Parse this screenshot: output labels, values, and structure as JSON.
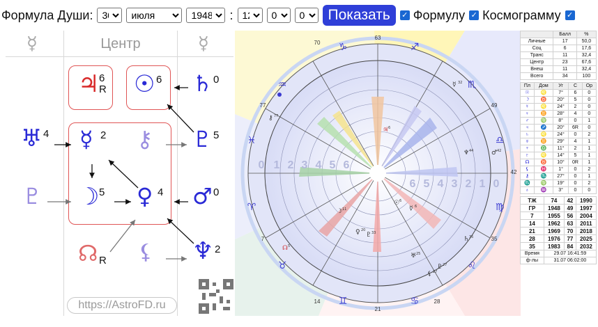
{
  "toolbar": {
    "formula_label": "Формула Души:",
    "day": "30",
    "month": "июля",
    "year": "1948",
    "colon": ":",
    "hour": "12",
    "minute": "00",
    "second": "00",
    "show_button": "Показать",
    "formula_checkbox": "Формулу",
    "cosmogram_checkbox": "Космограмму"
  },
  "formula": {
    "left_top_glyph": "☿",
    "center_title": "Центр",
    "right_top_glyph": "☿",
    "jupiter": {
      "glyph": "♃",
      "num": "6",
      "sub": "R"
    },
    "sun": {
      "glyph": "☉",
      "num": "6"
    },
    "saturn": {
      "glyph": "♄",
      "num": "0"
    },
    "uranus": {
      "glyph": "♅",
      "num": "4"
    },
    "mercury": {
      "glyph": "☿",
      "num": "2"
    },
    "chiron": {
      "glyph": "⚷",
      "num": ""
    },
    "pluto_right": {
      "glyph": "♇",
      "num": "5"
    },
    "pluto_left": {
      "glyph": "♇",
      "num": ""
    },
    "moon": {
      "glyph": "☽",
      "num": "5"
    },
    "venus": {
      "glyph": "♀",
      "num": "4"
    },
    "mars": {
      "glyph": "♂",
      "num": "0"
    },
    "node": {
      "glyph": "☊",
      "sub": "R"
    },
    "lilith": {
      "glyph": "⚸",
      "num": ""
    },
    "neptune": {
      "glyph": "♆",
      "num": "2"
    },
    "site": "https://AstroFD.ru"
  },
  "chart": {
    "degree_labels": [
      "63",
      "49",
      "42",
      "35",
      "28",
      "21",
      "14",
      "7",
      "77",
      "70"
    ],
    "ring_numbers_left": [
      "0",
      "1",
      "2",
      "3",
      "4",
      "5",
      "6"
    ],
    "ring_numbers_right": [
      "6",
      "5",
      "4",
      "3",
      "2",
      "1",
      "0"
    ],
    "zodiac": [
      "♈",
      "♉",
      "♊",
      "♋",
      "♌",
      "♍",
      "♎",
      "♏",
      "♐",
      "♑",
      "♒",
      "♓"
    ],
    "planet_marks": [
      {
        "glyph": "♃",
        "label": "6"
      },
      {
        "glyph": "♆",
        "label": "44"
      },
      {
        "glyph": "♂",
        "label": "42"
      },
      {
        "glyph": "☿",
        "label": "32"
      },
      {
        "glyph": "☊",
        "label": "5"
      },
      {
        "glyph": "☽",
        "label": "11"
      },
      {
        "glyph": "☉",
        "label": "6"
      },
      {
        "glyph": "☿",
        "label": "6"
      },
      {
        "glyph": "♀",
        "label": "20"
      },
      {
        "glyph": "♇",
        "label": "33"
      },
      {
        "glyph": "♄",
        "label": "35"
      },
      {
        "glyph": "♅",
        "label": "25"
      },
      {
        "glyph": "⚸",
        "label": "27"
      },
      {
        "glyph": "♇",
        "label": "27"
      },
      {
        "glyph": "⚷",
        "label": "77"
      }
    ]
  },
  "stats": {
    "header": [
      "",
      "Балл",
      "%"
    ],
    "rows": [
      [
        "Личные",
        "17",
        "50,0"
      ],
      [
        "Соц",
        "6",
        "17,6"
      ],
      [
        "Транс",
        "11",
        "32,4"
      ],
      [
        "Центр",
        "23",
        "67,6"
      ],
      [
        "Внеш",
        "11",
        "32,4"
      ],
      [
        "Всего",
        "34",
        "100"
      ]
    ],
    "planet_header": [
      "Пл",
      "Дом",
      "Уг",
      "С",
      "Ор"
    ],
    "planet_rows": [
      [
        "☉",
        "♌",
        "7°",
        "6",
        "0"
      ],
      [
        "☽",
        "♉",
        "20°",
        "5",
        "0"
      ],
      [
        "☿",
        "♌",
        "24°",
        "2",
        "0"
      ],
      [
        "♀",
        "♊",
        "28°",
        "4",
        "0"
      ],
      [
        "♂",
        "♍",
        "8°",
        "0",
        "1"
      ],
      [
        "♃",
        "♐",
        "20°",
        "6R",
        "0"
      ],
      [
        "♄",
        "♌",
        "24°",
        "0",
        "2"
      ],
      [
        "♅",
        "♊",
        "29°",
        "4",
        "1"
      ],
      [
        "♆",
        "♎",
        "11°",
        "2",
        "1"
      ],
      [
        "♇",
        "♌",
        "14°",
        "5",
        "1"
      ],
      [
        "☊",
        "♉",
        "10°",
        "0R",
        "1"
      ],
      [
        "⚸",
        "♓",
        "1°",
        "0",
        "2"
      ],
      [
        "⚷",
        "♏",
        "27°",
        "0",
        "1"
      ],
      [
        "♏",
        "♍",
        "19°",
        "0",
        "2"
      ],
      [
        "♁",
        "♒",
        "3°",
        "0",
        "0"
      ]
    ],
    "years": [
      [
        "ТЖ",
        "74",
        "42",
        "1990"
      ],
      [
        "ГР",
        "1948",
        "49",
        "1997"
      ],
      [
        "7",
        "1955",
        "56",
        "2004"
      ],
      [
        "14",
        "1962",
        "63",
        "2011"
      ],
      [
        "21",
        "1969",
        "70",
        "2018"
      ],
      [
        "28",
        "1976",
        "77",
        "2025"
      ],
      [
        "35",
        "1983",
        "84",
        "2032"
      ]
    ],
    "time_label": "Время",
    "time_value": "29.07 16:41:59",
    "fl_label": "ф-лы",
    "fl_value": "31.07 06:02:00"
  }
}
